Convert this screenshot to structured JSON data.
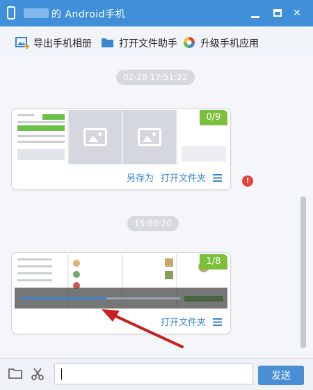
{
  "window": {
    "title": "的 Android手机",
    "minimize_icon": "minimize-icon",
    "maximize_icon": "maximize-icon",
    "close_icon": "close-icon"
  },
  "toolbar": {
    "items": [
      {
        "label": "导出手机相册",
        "icon": "export-photos-icon"
      },
      {
        "label": "打开文件助手",
        "icon": "folder-icon"
      },
      {
        "label": "升级手机应用",
        "icon": "upgrade-app-icon"
      }
    ]
  },
  "messages": [
    {
      "timestamp": "02-28 17:51:22",
      "badge": "0/9",
      "actions": [
        "另存为",
        "打开文件夹"
      ],
      "error": "!"
    },
    {
      "timestamp": "15:50:20",
      "badge": "1/8",
      "actions": [
        "打开文件夹"
      ]
    }
  ],
  "input": {
    "value": "",
    "send_label": "发送"
  },
  "colors": {
    "title_bar": "#3f8fd9",
    "accent": "#3a86d0",
    "badge": "#7bbf3a",
    "arrow": "#c8201e"
  }
}
